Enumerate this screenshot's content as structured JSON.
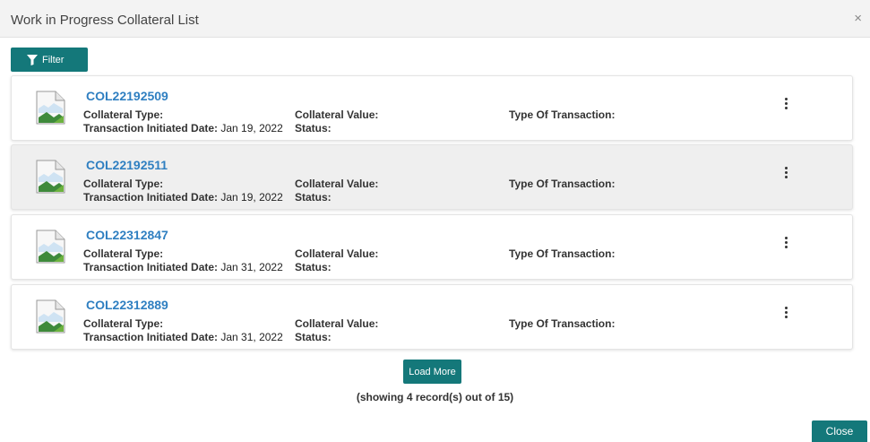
{
  "dialog": {
    "title": "Work in Progress Collateral List",
    "close_icon": "×"
  },
  "toolbar": {
    "filter_label": "Filter",
    "filter_icon": "filter-icon"
  },
  "labels": {
    "collateral_type": "Collateral Type:",
    "collateral_value": "Collateral Value:",
    "type_of_transaction": "Type Of Transaction:",
    "transaction_initiated_date": "Transaction Initiated Date:",
    "status": "Status:"
  },
  "records": [
    {
      "id": "COL22192509",
      "date": "Jan 19, 2022",
      "highlighted": false
    },
    {
      "id": "COL22192511",
      "date": "Jan 19, 2022",
      "highlighted": true
    },
    {
      "id": "COL22312847",
      "date": "Jan 31, 2022",
      "highlighted": false
    },
    {
      "id": "COL22312889",
      "date": "Jan 31, 2022",
      "highlighted": false
    }
  ],
  "footer": {
    "load_more_label": "Load More",
    "showing_text": "(showing 4 record(s) out of 15)",
    "close_label": "Close"
  },
  "colors": {
    "accent": "#14787a",
    "link": "#2f7fc1",
    "header_bg": "#f3f3f3",
    "highlight_bg": "#efefef"
  }
}
